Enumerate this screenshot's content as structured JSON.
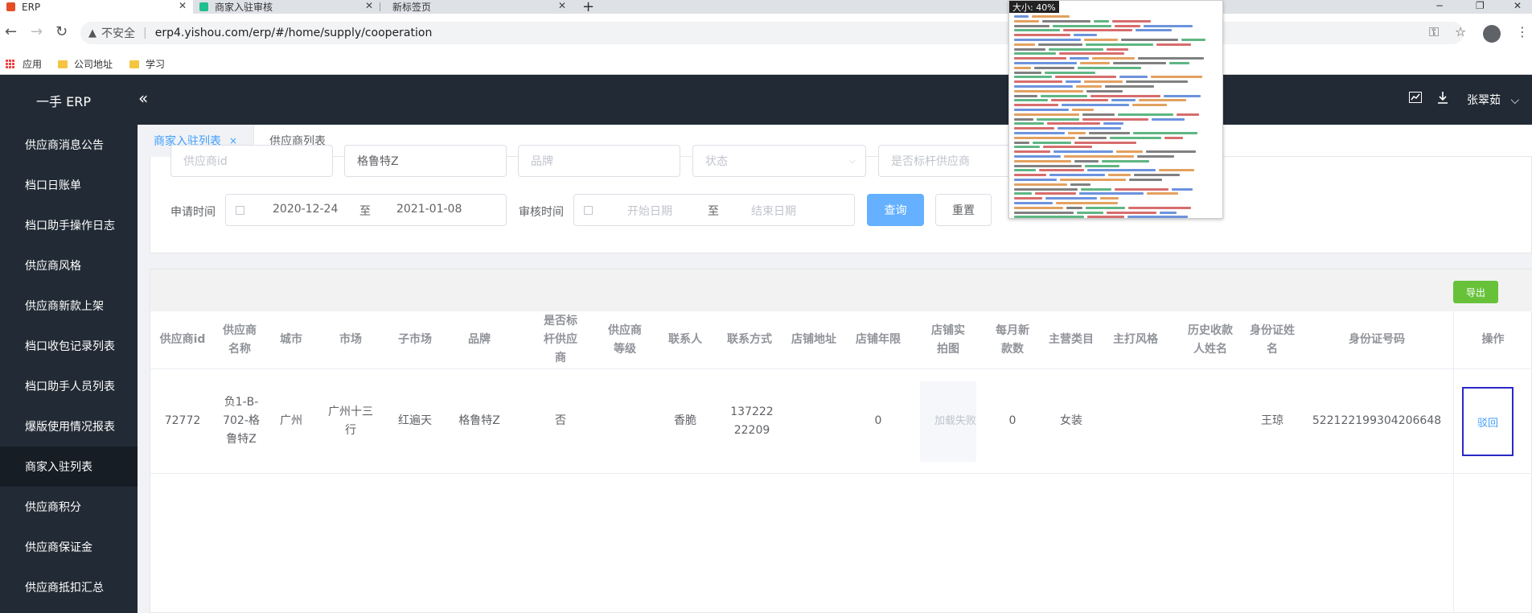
{
  "browser": {
    "tabs": [
      {
        "label": "ERP",
        "active": true
      },
      {
        "label": "商家入驻审核",
        "active": false
      },
      {
        "label": "新标签页",
        "active": false
      }
    ],
    "new_tab": "+",
    "window_controls": {
      "minimize": "−",
      "restore": "❐",
      "close": "✕"
    },
    "insecure_label": "不安全",
    "url": "erp4.yishou.com/erp/#/home/supply/cooperation",
    "bookmarks": [
      "应用",
      "公司地址",
      "学习"
    ]
  },
  "header": {
    "logo": "一手 ERP",
    "collapse_icon": "«",
    "user": "张翠茹",
    "user_chevron": "⌵"
  },
  "sidebar": {
    "items": [
      {
        "label": "供应商消息公告"
      },
      {
        "label": "档口日账单"
      },
      {
        "label": "档口助手操作日志"
      },
      {
        "label": "供应商风格"
      },
      {
        "label": "供应商新款上架"
      },
      {
        "label": "档口收包记录列表"
      },
      {
        "label": "档口助手人员列表"
      },
      {
        "label": "爆版使用情况报表"
      },
      {
        "label": "商家入驻列表",
        "active": true
      },
      {
        "label": "供应商积分"
      },
      {
        "label": "供应商保证金"
      },
      {
        "label": "供应商抵扣汇总"
      }
    ]
  },
  "page_tabs": [
    {
      "label": "商家入驻列表",
      "close": "×",
      "active": true
    },
    {
      "label": "供应商列表",
      "active": false
    }
  ],
  "filters": {
    "supplier_id_placeholder": "供应商id",
    "brand_value": "格鲁特Z",
    "brand_placeholder": "品牌",
    "status_placeholder": "状态",
    "benchmark_placeholder": "是否标杆供应商",
    "apply_time_label": "申请时间",
    "apply_start": "2020-12-24",
    "apply_to": "至",
    "apply_end": "2021-01-08",
    "audit_time_label": "审核时间",
    "audit_start_placeholder": "开始日期",
    "audit_to": "至",
    "audit_end_placeholder": "结束日期",
    "query_button": "查询",
    "reset_button": "重置"
  },
  "table": {
    "export_button": "导出",
    "columns": [
      "供应商id",
      "供应商名称",
      "城市",
      "市场",
      "子市场",
      "品牌",
      "是否标杆供应商",
      "供应商等级",
      "联系人",
      "联系方式",
      "店铺地址",
      "店铺年限",
      "店铺实拍图",
      "每月新款数",
      "主营类目",
      "主打风格",
      "历史收款人姓名",
      "身份证姓名",
      "身份证号码",
      "操作"
    ],
    "rows": [
      {
        "supplier_id": "72772",
        "supplier_name": "负1-B-702-格鲁特Z",
        "city": "广州",
        "market": "广州十三行",
        "sub_market": "红遍天",
        "brand": "格鲁特Z",
        "is_benchmark": "否",
        "level": "",
        "contact": "香脆",
        "phone": "13722222209",
        "address": "",
        "store_years": "0",
        "photo": "加载失败",
        "monthly_new": "0",
        "category": "女装",
        "style": "",
        "history_payee": "",
        "id_name": "王琼",
        "id_number": "522122199304206648",
        "action": "驳回"
      }
    ]
  },
  "overlay": {
    "size_label": "大小: 40%"
  }
}
